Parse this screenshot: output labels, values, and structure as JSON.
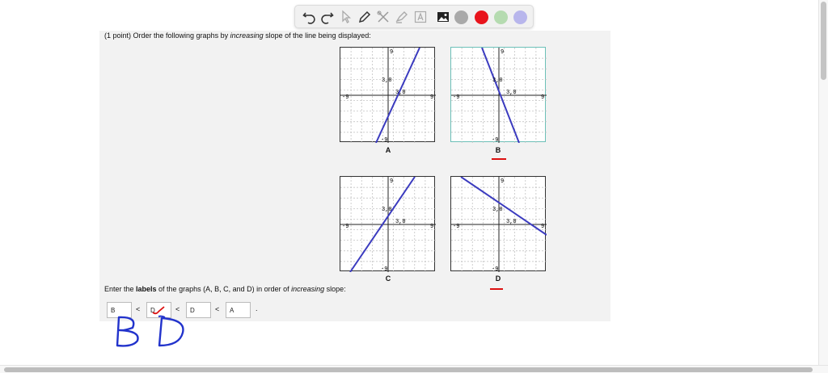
{
  "problem": {
    "prompt_lead": "(1 point) Order the following graphs by ",
    "prompt_em": "increasing",
    "prompt_tail": " slope of the line being displayed:",
    "instr_lead": "Enter the ",
    "instr_bold": "labels",
    "instr_mid": " of the graphs (A, B, C, and D) in order of ",
    "instr_em": "increasing",
    "instr_tail": " slope:"
  },
  "graphs": [
    {
      "label": "A",
      "tick_label": "3,0",
      "y_label": "3,0",
      "xmin": "-9",
      "xmax": "9",
      "ymax": "9",
      "ymin": "-9",
      "slope_note": "positive steep"
    },
    {
      "label": "B",
      "tick_label": "3,0",
      "y_label": "3,0",
      "xmin": "-9",
      "xmax": "9",
      "ymax": "9",
      "ymin": "-9"
    },
    {
      "label": "C",
      "tick_label": "3,0",
      "y_label": "3,0",
      "xmin": "-9",
      "xmax": "9",
      "ymax": "9",
      "ymin": "-9"
    },
    {
      "label": "D",
      "tick_label": "3,0",
      "y_label": "3,0",
      "xmin": "-9",
      "xmax": "9",
      "ymax": "9",
      "ymin": "-9"
    }
  ],
  "answers": {
    "box1": "B",
    "box2": "D",
    "box3": "D",
    "box4": "A",
    "separator": "<",
    "end": "."
  },
  "handwriting": {
    "text": "B D",
    "color": "#2233cc"
  },
  "toolbar": {
    "colors": [
      "#a9a9a9",
      "#e8141c",
      "#b5dbb0",
      "#b8b6ec"
    ],
    "icons": [
      "undo-icon",
      "redo-icon",
      "pointer-icon",
      "pen-icon",
      "tools-icon",
      "highlighter-icon",
      "text-icon",
      "image-icon"
    ]
  },
  "colors": {
    "line": "#3b3bbf",
    "accent_red": "#d11111",
    "selected_border": "#6cc0b8"
  }
}
